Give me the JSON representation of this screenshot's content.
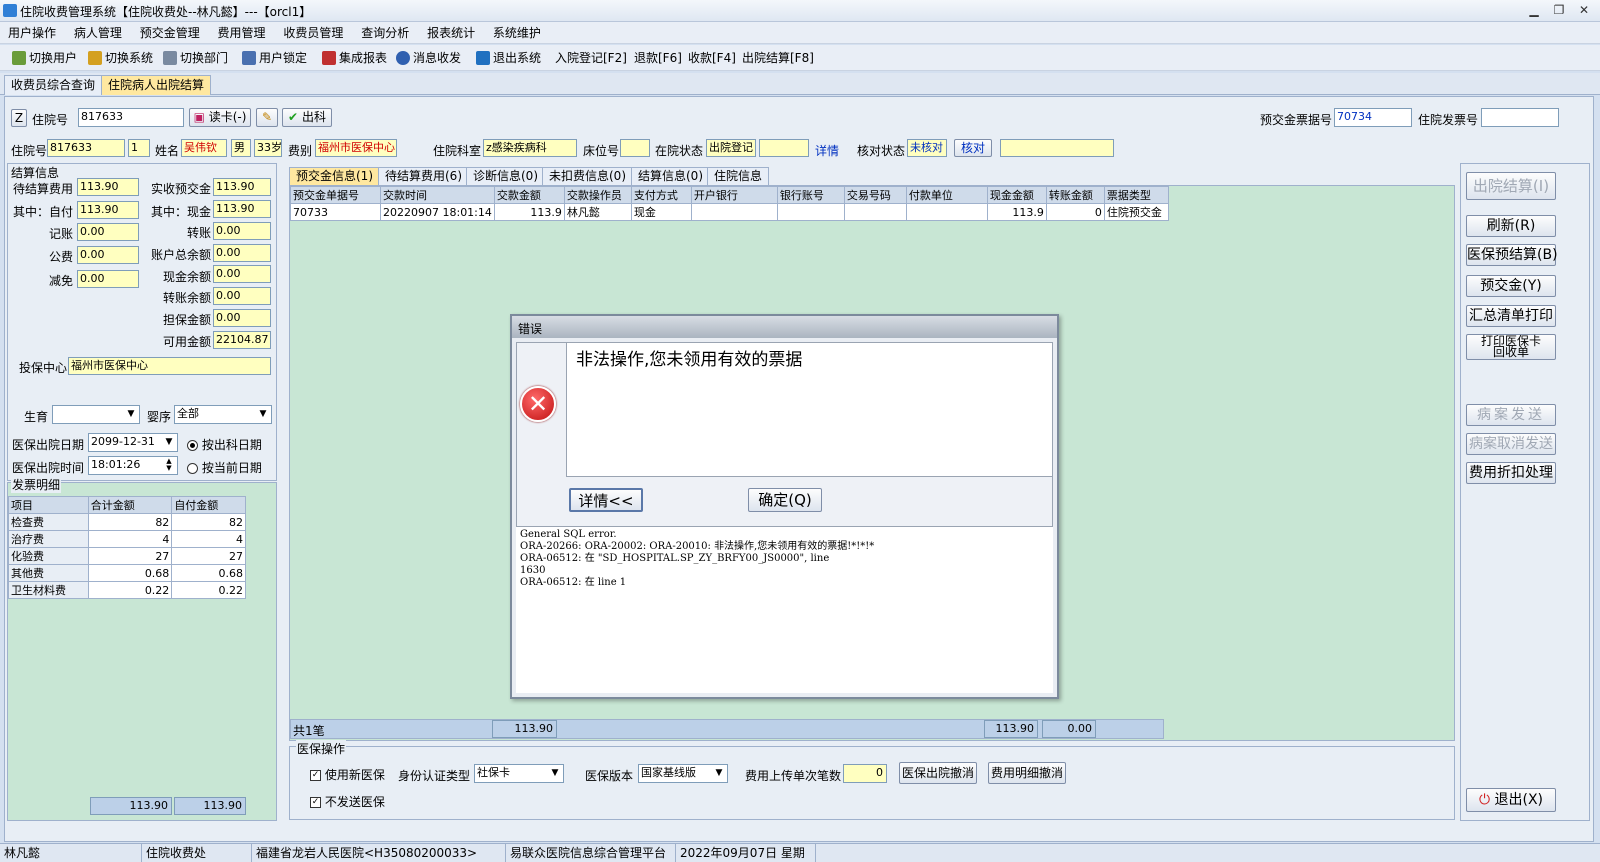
{
  "window": {
    "title": "住院收费管理系统【住院收费处--林凡懿】---【orcl1】"
  },
  "menu": [
    "用户操作",
    "病人管理",
    "预交金管理",
    "费用管理",
    "收费员管理",
    "查询分析",
    "报表统计",
    "系统维护"
  ],
  "toolbar": {
    "switch_user": "切换用户",
    "switch_system": "切换系统",
    "switch_dept": "切换部门",
    "lock_user": "用户锁定",
    "report": "集成报表",
    "message": "消息收发",
    "exit_system": "退出系统",
    "admit": "入院登记[F2]",
    "refund": "退款[F6]",
    "charge": "收款[F4]",
    "discharge": "出院结算[F8]"
  },
  "top_tabs": {
    "tab1": "收费员综合查询",
    "tab2": "住院病人出院结算"
  },
  "header": {
    "z_label": "Z",
    "inpatient_no_label": "住院号",
    "inpatient_no": "817633",
    "read_card": "读卡(-)",
    "discharge_btn": "出科",
    "prepay_no_label": "预交金票据号",
    "prepay_no": "70734",
    "invoice_no_label": "住院发票号",
    "invoice_no": ""
  },
  "patient": {
    "inpatient_no_label": "住院号",
    "inpatient_no": "817633",
    "times": "1",
    "name_label": "姓名",
    "name": "吴伟钦",
    "sex": "男",
    "age": "33岁",
    "fee_type_label": "费别",
    "fee_type": "福州市医保中心",
    "dept_label": "住院科室",
    "dept": "z感染疾病科",
    "bed_label": "床位号",
    "bed": "",
    "status_label": "在院状态",
    "status": "出院登记",
    "status_extra": "",
    "detail_link": "详情",
    "check_status_label": "核对状态",
    "check_status": "未核对",
    "check_btn": "核对",
    "check_extra": ""
  },
  "settle": {
    "title": "结算信息",
    "pending_label": "待结算费用",
    "pending": "113.90",
    "self_label": "其中：自付",
    "self": "113.90",
    "record_label": "记账",
    "record": "0.00",
    "public_label": "公费",
    "public": "0.00",
    "reduce_label": "减免",
    "reduce": "0.00",
    "actual_prepay_label": "实收预交金",
    "actual_prepay": "113.90",
    "cash_label": "其中：现金",
    "cash": "113.90",
    "transfer_label": "转账",
    "transfer": "0.00",
    "account_total_label": "账户总余额",
    "account_total": "0.00",
    "cash_balance_label": "现金余额",
    "cash_balance": "0.00",
    "transfer_balance_label": "转账余额",
    "transfer_balance": "0.00",
    "guarantee_label": "担保金额",
    "guarantee": "0.00",
    "available_label": "可用金额",
    "available": "22104.87",
    "insure_center_label": "投保中心",
    "insure_center": "福州市医保中心",
    "birth_label": "生育",
    "birth": "",
    "order_label": "婴序",
    "order": "全部",
    "out_date_label": "医保出院日期",
    "out_date": "2099-12-31",
    "out_time_label": "医保出院时间",
    "out_time": "18:01:26",
    "radio1": "按出科日期",
    "radio2": "按当前日期"
  },
  "invoice": {
    "title": "发票明细",
    "headers": [
      "项目",
      "合计金额",
      "自付金额"
    ],
    "rows": [
      [
        "检查费",
        "82",
        "82"
      ],
      [
        "治疗费",
        "4",
        "4"
      ],
      [
        "化验费",
        "27",
        "27"
      ],
      [
        "其他费",
        "0.68",
        "0.68"
      ],
      [
        "卫生材料费",
        "0.22",
        "0.22"
      ]
    ],
    "total1": "113.90",
    "total2": "113.90"
  },
  "info_tabs": [
    "预交金信息(1)",
    "待结算费用(6)",
    "诊断信息(0)",
    "未扣费信息(0)",
    "结算信息(0)",
    "住院信息"
  ],
  "prepay_table": {
    "headers": [
      "预交金单据号",
      "交款时间",
      "交款金额",
      "交款操作员",
      "支付方式",
      "开户银行",
      "银行账号",
      "交易号码",
      "付款单位",
      "现金金额",
      "转账金额",
      "票据类型"
    ],
    "rows": [
      [
        "70733",
        "20220907 18:01:14",
        "113.9",
        "林凡懿",
        "现金",
        "",
        "",
        "",
        "",
        "113.9",
        "0",
        "住院预交金"
      ]
    ],
    "footer_count": "共1笔",
    "footer_amount": "113.90",
    "footer_cash": "113.90",
    "footer_transfer": "0.00"
  },
  "right_buttons": {
    "discharge_settle": "出院结算(I)",
    "refresh": "刷新(R)",
    "ins_pre_settle": "医保预结算(B)",
    "prepay": "预交金(Y)",
    "summary_print": "汇总清单打印",
    "print_card_line1": "打印医保卡",
    "print_card_line2": "回收单",
    "case_send": "病案发送",
    "case_cancel": "病案取消发送",
    "fee_discount": "费用折扣处理",
    "exit": "退出(X)"
  },
  "ins_ops": {
    "title": "医保操作",
    "use_new": "使用新医保",
    "no_send": "不发送医保",
    "id_type_label": "身份认证类型",
    "id_type": "社保卡",
    "version_label": "医保版本",
    "version": "国家基线版",
    "upload_label": "费用上传单次笔数",
    "upload": "0",
    "cancel_discharge": "医保出院撤消",
    "cancel_detail": "费用明细撤消"
  },
  "dialog": {
    "caption": "错误",
    "message": "非法操作,您未领用有效的票据",
    "detail_btn": "详情<<",
    "ok_btn": "确定(Q)",
    "detail_lines": [
      "General SQL error.",
      "ORA-20266: ORA-20002: ORA-20010: 非法操作,您未领用有效的票据!*!*!*",
      "ORA-06512: 在 \"SD_HOSPITAL.SP_ZY_BRFY00_JS0000\", line",
      "1630",
      "ORA-06512: 在 line 1"
    ]
  },
  "status": {
    "user": "林凡懿",
    "dept": "住院收费处",
    "hospital": "福建省龙岩人民医院<H35080200033>",
    "platform": "易联众医院信息综合管理平台",
    "date": "2022年09月07日 星期三"
  },
  "colors": {
    "field_yellow": "#ffffc0",
    "grid_green": "#c8e6d4",
    "error_red": "#d92020"
  }
}
